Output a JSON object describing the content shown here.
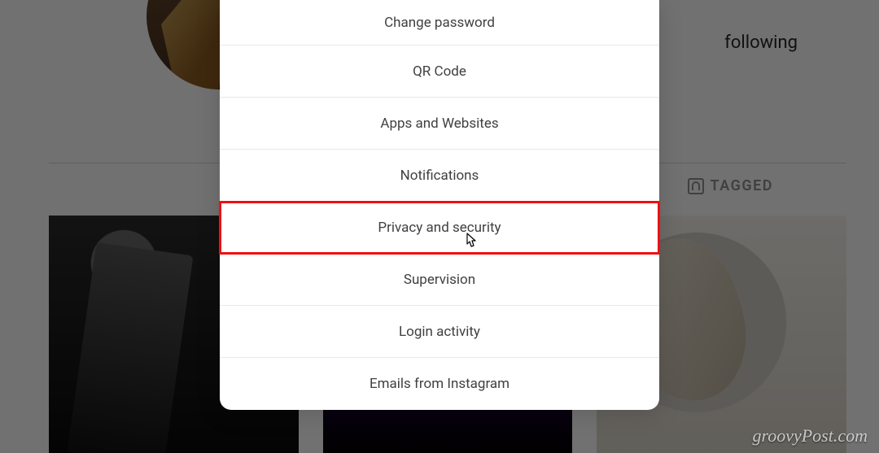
{
  "profile": {
    "following_label": "following",
    "tab_tagged_label": "TAGGED"
  },
  "settings_menu": {
    "items": [
      {
        "label": "Change password"
      },
      {
        "label": "QR Code"
      },
      {
        "label": "Apps and Websites"
      },
      {
        "label": "Notifications"
      },
      {
        "label": "Privacy and security",
        "highlighted": true
      },
      {
        "label": "Supervision"
      },
      {
        "label": "Login activity"
      },
      {
        "label": "Emails from Instagram"
      }
    ]
  },
  "annotation": {
    "highlight_color": "#ee1111"
  },
  "watermark": "groovyPost.com"
}
